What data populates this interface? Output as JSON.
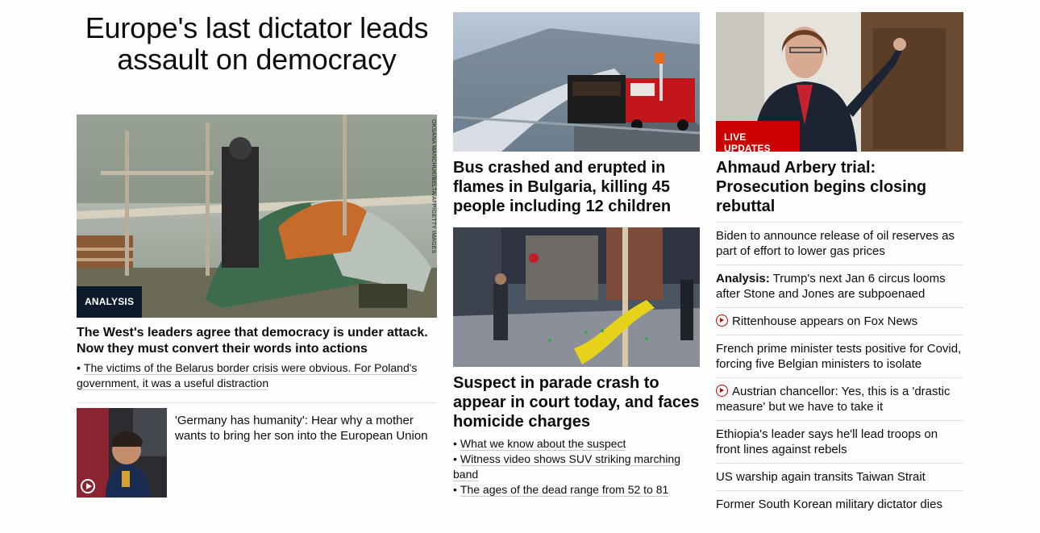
{
  "left": {
    "hero_title": "Europe's last dictator leads assault on democracy",
    "photo_credit": "OKSANA MANCHUK/BELTA/AFP/GETTY IMAGES",
    "analysis_badge": "ANALYSIS",
    "lead_headline": "The West's leaders agree that democracy is under attack. Now they must convert their words into actions",
    "bullets": [
      "The victims of the Belarus border crisis were obvious. For Poland's government, it was a useful distraction"
    ],
    "card": {
      "text": "'Germany has humanity': Hear why a mother wants to bring her son into the European Union",
      "play_icon": "play-circle-icon"
    }
  },
  "middle": {
    "story1": {
      "headline": "Bus crashed and erupted in flames in Bulgaria, killing 45 people including 12 children"
    },
    "story2": {
      "headline": "Suspect in parade crash to appear in court today, and faces homicide charges",
      "bullets": [
        "What we know about the suspect",
        "Witness video shows SUV striking marching band",
        "The ages of the dead range from 52 to 81"
      ]
    }
  },
  "right": {
    "live_badge": "LIVE UPDATES",
    "lead_headline": "Ahmaud Arbery trial: Prosecution begins closing rebuttal",
    "items": [
      {
        "prefix": "",
        "text": "Biden to announce release of oil reserves as part of effort to lower gas prices",
        "video": false
      },
      {
        "prefix": "Analysis:",
        "text": " Trump's next Jan 6 circus looms after Stone and Jones are subpoenaed",
        "video": false
      },
      {
        "prefix": "",
        "text": "Rittenhouse appears on Fox News",
        "video": true
      },
      {
        "prefix": "",
        "text": "French prime minister tests positive for Covid, forcing five Belgian ministers to isolate",
        "video": false
      },
      {
        "prefix": "",
        "text": "Austrian chancellor: Yes, this is a 'drastic measure' but we have to take it",
        "video": true
      },
      {
        "prefix": "",
        "text": "Ethiopia's leader says he'll lead troops on front lines against rebels",
        "video": false
      },
      {
        "prefix": "",
        "text": "US warship again transits Taiwan Strait",
        "video": false
      },
      {
        "prefix": "",
        "text": "Former South Korean military dictator dies",
        "video": false
      }
    ]
  },
  "colors": {
    "breaking_red": "#cc0000",
    "analysis_navy": "#0c1a2c",
    "text": "#0c0c0c",
    "divider": "#e1e1e1"
  }
}
